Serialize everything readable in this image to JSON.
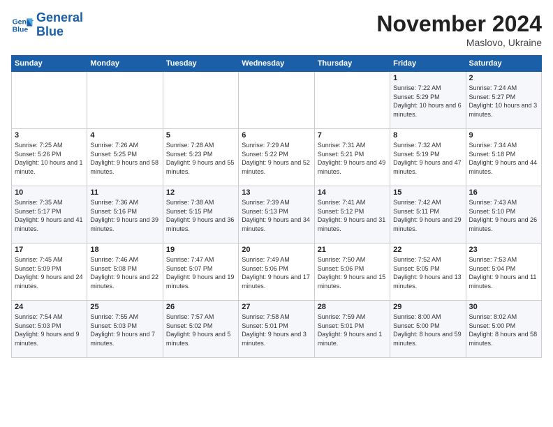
{
  "logo": {
    "line1": "General",
    "line2": "Blue"
  },
  "title": "November 2024",
  "subtitle": "Maslovo, Ukraine",
  "days_header": [
    "Sunday",
    "Monday",
    "Tuesday",
    "Wednesday",
    "Thursday",
    "Friday",
    "Saturday"
  ],
  "weeks": [
    [
      {
        "num": "",
        "info": ""
      },
      {
        "num": "",
        "info": ""
      },
      {
        "num": "",
        "info": ""
      },
      {
        "num": "",
        "info": ""
      },
      {
        "num": "",
        "info": ""
      },
      {
        "num": "1",
        "info": "Sunrise: 7:22 AM\nSunset: 5:29 PM\nDaylight: 10 hours\nand 6 minutes."
      },
      {
        "num": "2",
        "info": "Sunrise: 7:24 AM\nSunset: 5:27 PM\nDaylight: 10 hours\nand 3 minutes."
      }
    ],
    [
      {
        "num": "3",
        "info": "Sunrise: 7:25 AM\nSunset: 5:26 PM\nDaylight: 10 hours\nand 1 minute."
      },
      {
        "num": "4",
        "info": "Sunrise: 7:26 AM\nSunset: 5:25 PM\nDaylight: 9 hours\nand 58 minutes."
      },
      {
        "num": "5",
        "info": "Sunrise: 7:28 AM\nSunset: 5:23 PM\nDaylight: 9 hours\nand 55 minutes."
      },
      {
        "num": "6",
        "info": "Sunrise: 7:29 AM\nSunset: 5:22 PM\nDaylight: 9 hours\nand 52 minutes."
      },
      {
        "num": "7",
        "info": "Sunrise: 7:31 AM\nSunset: 5:21 PM\nDaylight: 9 hours\nand 49 minutes."
      },
      {
        "num": "8",
        "info": "Sunrise: 7:32 AM\nSunset: 5:19 PM\nDaylight: 9 hours\nand 47 minutes."
      },
      {
        "num": "9",
        "info": "Sunrise: 7:34 AM\nSunset: 5:18 PM\nDaylight: 9 hours\nand 44 minutes."
      }
    ],
    [
      {
        "num": "10",
        "info": "Sunrise: 7:35 AM\nSunset: 5:17 PM\nDaylight: 9 hours\nand 41 minutes."
      },
      {
        "num": "11",
        "info": "Sunrise: 7:36 AM\nSunset: 5:16 PM\nDaylight: 9 hours\nand 39 minutes."
      },
      {
        "num": "12",
        "info": "Sunrise: 7:38 AM\nSunset: 5:15 PM\nDaylight: 9 hours\nand 36 minutes."
      },
      {
        "num": "13",
        "info": "Sunrise: 7:39 AM\nSunset: 5:13 PM\nDaylight: 9 hours\nand 34 minutes."
      },
      {
        "num": "14",
        "info": "Sunrise: 7:41 AM\nSunset: 5:12 PM\nDaylight: 9 hours\nand 31 minutes."
      },
      {
        "num": "15",
        "info": "Sunrise: 7:42 AM\nSunset: 5:11 PM\nDaylight: 9 hours\nand 29 minutes."
      },
      {
        "num": "16",
        "info": "Sunrise: 7:43 AM\nSunset: 5:10 PM\nDaylight: 9 hours\nand 26 minutes."
      }
    ],
    [
      {
        "num": "17",
        "info": "Sunrise: 7:45 AM\nSunset: 5:09 PM\nDaylight: 9 hours\nand 24 minutes."
      },
      {
        "num": "18",
        "info": "Sunrise: 7:46 AM\nSunset: 5:08 PM\nDaylight: 9 hours\nand 22 minutes."
      },
      {
        "num": "19",
        "info": "Sunrise: 7:47 AM\nSunset: 5:07 PM\nDaylight: 9 hours\nand 19 minutes."
      },
      {
        "num": "20",
        "info": "Sunrise: 7:49 AM\nSunset: 5:06 PM\nDaylight: 9 hours\nand 17 minutes."
      },
      {
        "num": "21",
        "info": "Sunrise: 7:50 AM\nSunset: 5:06 PM\nDaylight: 9 hours\nand 15 minutes."
      },
      {
        "num": "22",
        "info": "Sunrise: 7:52 AM\nSunset: 5:05 PM\nDaylight: 9 hours\nand 13 minutes."
      },
      {
        "num": "23",
        "info": "Sunrise: 7:53 AM\nSunset: 5:04 PM\nDaylight: 9 hours\nand 11 minutes."
      }
    ],
    [
      {
        "num": "24",
        "info": "Sunrise: 7:54 AM\nSunset: 5:03 PM\nDaylight: 9 hours\nand 9 minutes."
      },
      {
        "num": "25",
        "info": "Sunrise: 7:55 AM\nSunset: 5:03 PM\nDaylight: 9 hours\nand 7 minutes."
      },
      {
        "num": "26",
        "info": "Sunrise: 7:57 AM\nSunset: 5:02 PM\nDaylight: 9 hours\nand 5 minutes."
      },
      {
        "num": "27",
        "info": "Sunrise: 7:58 AM\nSunset: 5:01 PM\nDaylight: 9 hours\nand 3 minutes."
      },
      {
        "num": "28",
        "info": "Sunrise: 7:59 AM\nSunset: 5:01 PM\nDaylight: 9 hours\nand 1 minute."
      },
      {
        "num": "29",
        "info": "Sunrise: 8:00 AM\nSunset: 5:00 PM\nDaylight: 8 hours\nand 59 minutes."
      },
      {
        "num": "30",
        "info": "Sunrise: 8:02 AM\nSunset: 5:00 PM\nDaylight: 8 hours\nand 58 minutes."
      }
    ]
  ]
}
